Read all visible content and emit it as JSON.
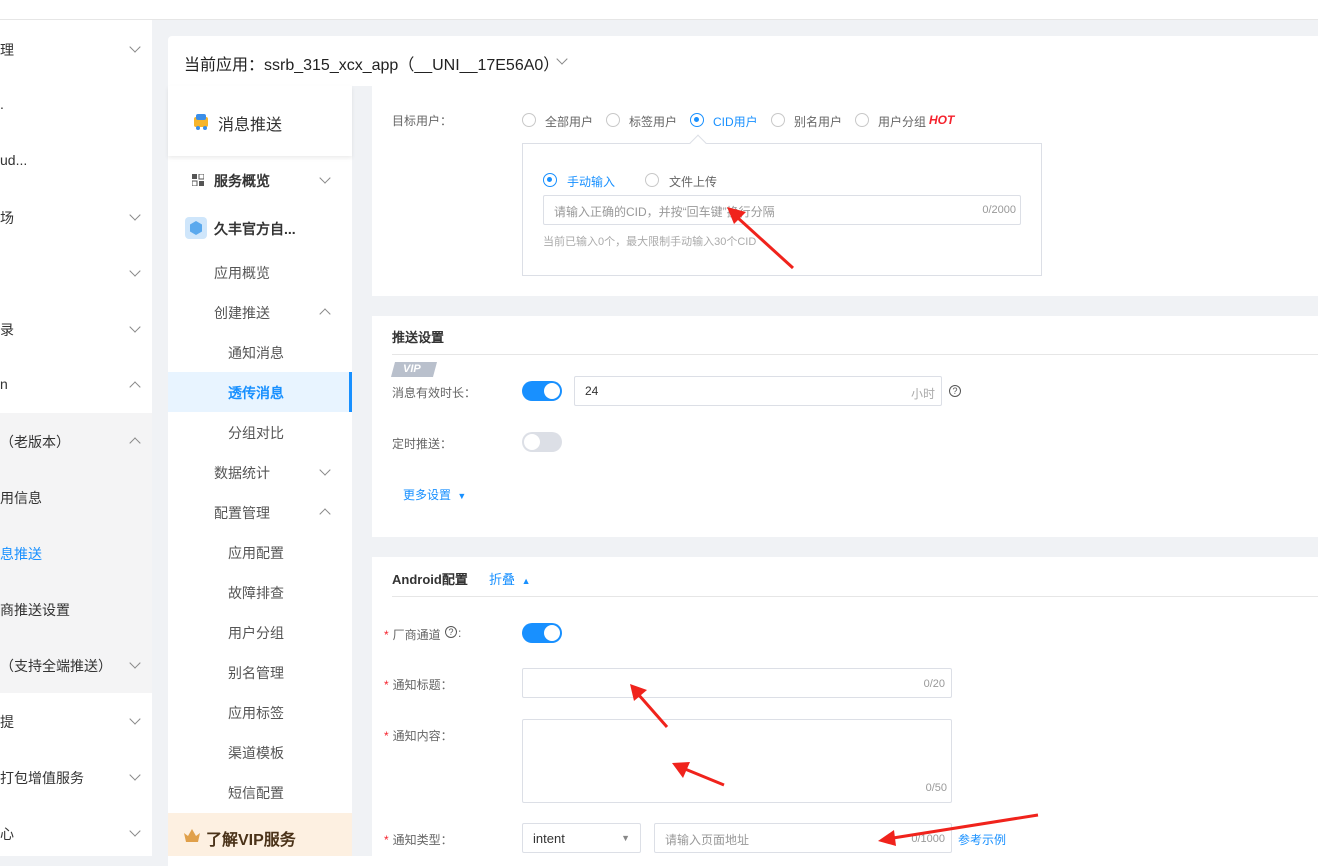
{
  "left_nav": {
    "items": [
      {
        "label": "理"
      },
      {
        "label": "."
      },
      {
        "label": "ud..."
      },
      {
        "label": "场"
      },
      {
        "label": ""
      },
      {
        "label": "录"
      },
      {
        "label": "n"
      },
      {
        "label": "（老版本）"
      },
      {
        "label": "用信息"
      },
      {
        "label": "息推送"
      },
      {
        "label": "商推送设置"
      },
      {
        "label": "（支持全端推送）"
      },
      {
        "label": "提"
      },
      {
        "label": "打包增值服务"
      },
      {
        "label": "心"
      }
    ]
  },
  "header": {
    "app_label": "当前应用：ssrb_315_xcx_app（__UNI__17E56A0）"
  },
  "sub_nav": {
    "title": "消息推送",
    "service_overview": "服务概览",
    "app_name": "久丰官方自...",
    "app_overview": "应用概览",
    "create_push": "创建推送",
    "notify_msg": "通知消息",
    "transparent_msg": "透传消息",
    "group_compare": "分组对比",
    "data_stats": "数据统计",
    "config_manage": "配置管理",
    "app_config": "应用配置",
    "troubleshoot": "故障排查",
    "user_group": "用户分组",
    "alias_manage": "别名管理",
    "app_tags": "应用标签",
    "channel_template": "渠道模板",
    "sms_config": "短信配置",
    "vip_banner": "了解VIP服务"
  },
  "target": {
    "label": "目标用户：",
    "options": [
      "全部用户",
      "标签用户",
      "CID用户",
      "别名用户",
      "用户分组"
    ],
    "hot_badge": "HOT",
    "input_modes": [
      "手动输入",
      "文件上传"
    ],
    "cid_placeholder": "请输入正确的CID，并按“回车键”换行分隔",
    "cid_count": "0/2000",
    "cid_hint": "当前已输入0个，最大限制手动输入30个CID"
  },
  "push_settings": {
    "title": "推送设置",
    "vip_badge": "VIP",
    "validity_label": "消息有效时长：",
    "validity_value": "24",
    "validity_unit": "小时",
    "scheduled_label": "定时推送：",
    "more_settings": "更多设置"
  },
  "android": {
    "title": "Android配置",
    "collapse": "折叠",
    "vendor_label": "厂商通道",
    "title_label": "通知标题：",
    "title_count": "0/20",
    "content_label": "通知内容：",
    "content_count": "0/50",
    "type_label": "通知类型：",
    "type_value": "intent",
    "url_placeholder": "请输入页面地址",
    "url_count": "0/1000",
    "example_link": "参考示例"
  },
  "colors": {
    "primary": "#1890ff",
    "hot": "#f5222d",
    "arrow": "#f0231c"
  }
}
